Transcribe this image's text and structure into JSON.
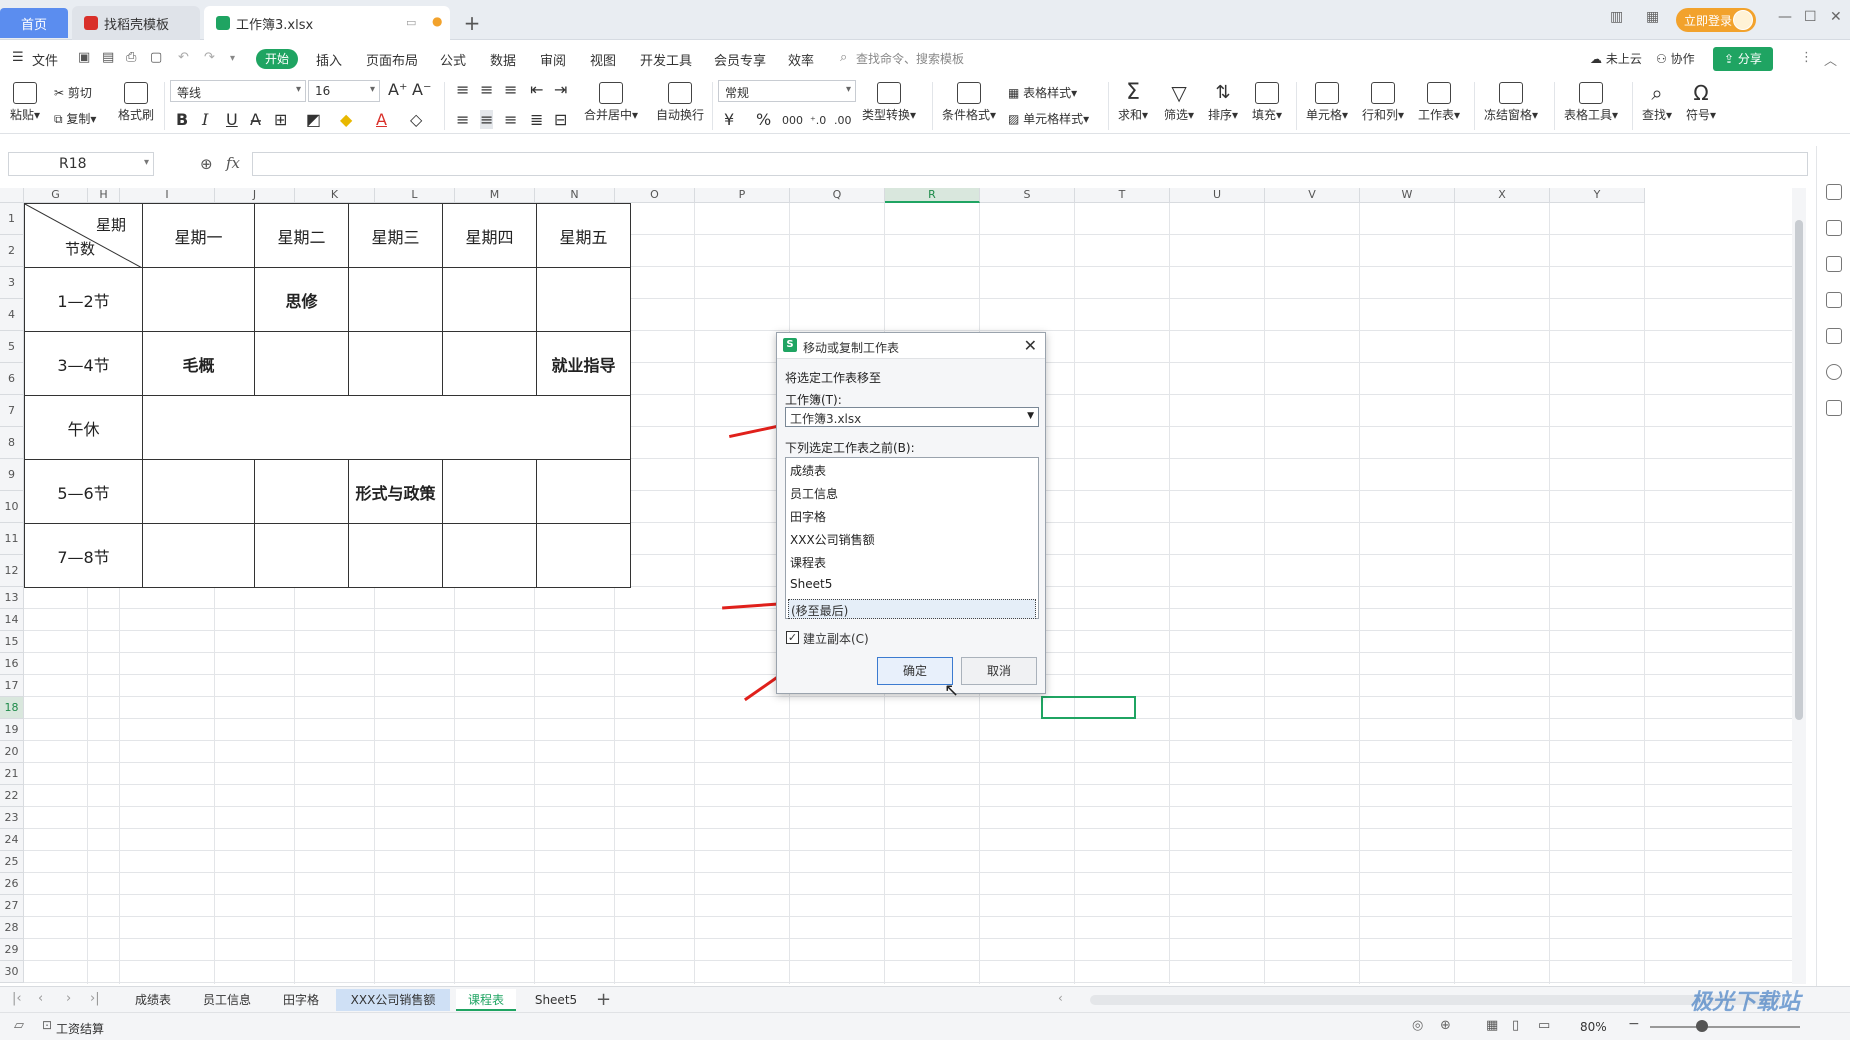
{
  "titlebar": {
    "home_tab": "首页",
    "template_tab": "找稻壳模板",
    "workbook_tab": "工作簿3.xlsx",
    "login": "立即登录"
  },
  "menu": {
    "file": "文件",
    "start": "开始",
    "items": [
      "插入",
      "页面布局",
      "公式",
      "数据",
      "审阅",
      "视图",
      "开发工具",
      "会员专享",
      "效率"
    ],
    "search": "查找命令、搜索模板",
    "cloud": "未上云",
    "collab": "协作",
    "share": "分享"
  },
  "ribbon": {
    "paste": "粘贴",
    "cut": "剪切",
    "copy": "复制",
    "format_painter": "格式刷",
    "font_name": "等线",
    "font_size": "16",
    "merge": "合并居中",
    "wrap": "自动换行",
    "number_format": "常规",
    "type_convert": "类型转换",
    "cond_format": "条件格式",
    "table_style": "表格样式",
    "cell_style": "单元格样式",
    "sum": "求和",
    "filter": "筛选",
    "sort": "排序",
    "fill": "填充",
    "cell": "单元格",
    "rowcol": "行和列",
    "worksheet": "工作表",
    "freeze": "冻结窗格",
    "table_tools": "表格工具",
    "find": "查找",
    "symbol": "符号"
  },
  "formula_bar": {
    "cell_ref": "R18",
    "fx": "fx",
    "formula": ""
  },
  "grid": {
    "columns": [
      "G",
      "H",
      "I",
      "J",
      "K",
      "L",
      "M",
      "N",
      "O",
      "P",
      "Q",
      "R",
      "S",
      "T",
      "U",
      "V",
      "W",
      "X",
      "Y"
    ],
    "rows": [
      "1",
      "2",
      "3",
      "4",
      "5",
      "6",
      "7",
      "8",
      "9",
      "10",
      "11",
      "12",
      "13",
      "14",
      "15",
      "16",
      "17",
      "18",
      "19",
      "20",
      "21",
      "22",
      "23",
      "24",
      "25",
      "26",
      "27",
      "28",
      "29",
      "30"
    ],
    "active_column": "R",
    "active_row": "18"
  },
  "schedule": {
    "corner_top": "星期",
    "corner_bottom": "节数",
    "days": [
      "星期一",
      "星期二",
      "星期三",
      "星期四",
      "星期五"
    ],
    "periods": [
      "1—2节",
      "3—4节",
      "午休",
      "5—6节",
      "7—8节"
    ],
    "cell_sixiu": "思修",
    "cell_maogai": "毛概",
    "cell_jiuye": "就业指导",
    "cell_xingshi": "形式与政策"
  },
  "dialog": {
    "title": "移动或复制工作表",
    "move_to": "将选定工作表移至",
    "workbook_label": "工作簿(T):",
    "workbook_value": "工作簿3.xlsx",
    "before_label": "下列选定工作表之前(B):",
    "sheets": [
      "成绩表",
      "员工信息",
      "田字格",
      "XXX公司销售额",
      "课程表",
      "Sheet5"
    ],
    "move_last": "(移至最后)",
    "create_copy": "建立副本(C)",
    "create_copy_checked": true,
    "ok": "确定",
    "cancel": "取消"
  },
  "sheet_tabs": {
    "tabs": [
      "成绩表",
      "员工信息",
      "田字格",
      "XXX公司销售额",
      "课程表",
      "Sheet5"
    ],
    "active": "课程表",
    "highlighted": "XXX公司销售额"
  },
  "status": {
    "mode": "工资结算",
    "zoom": "80%"
  },
  "watermark": "极光下载站",
  "colors": {
    "accent_green": "#1fa462",
    "home_blue": "#5b8def",
    "arrow_red": "#e0201b"
  }
}
